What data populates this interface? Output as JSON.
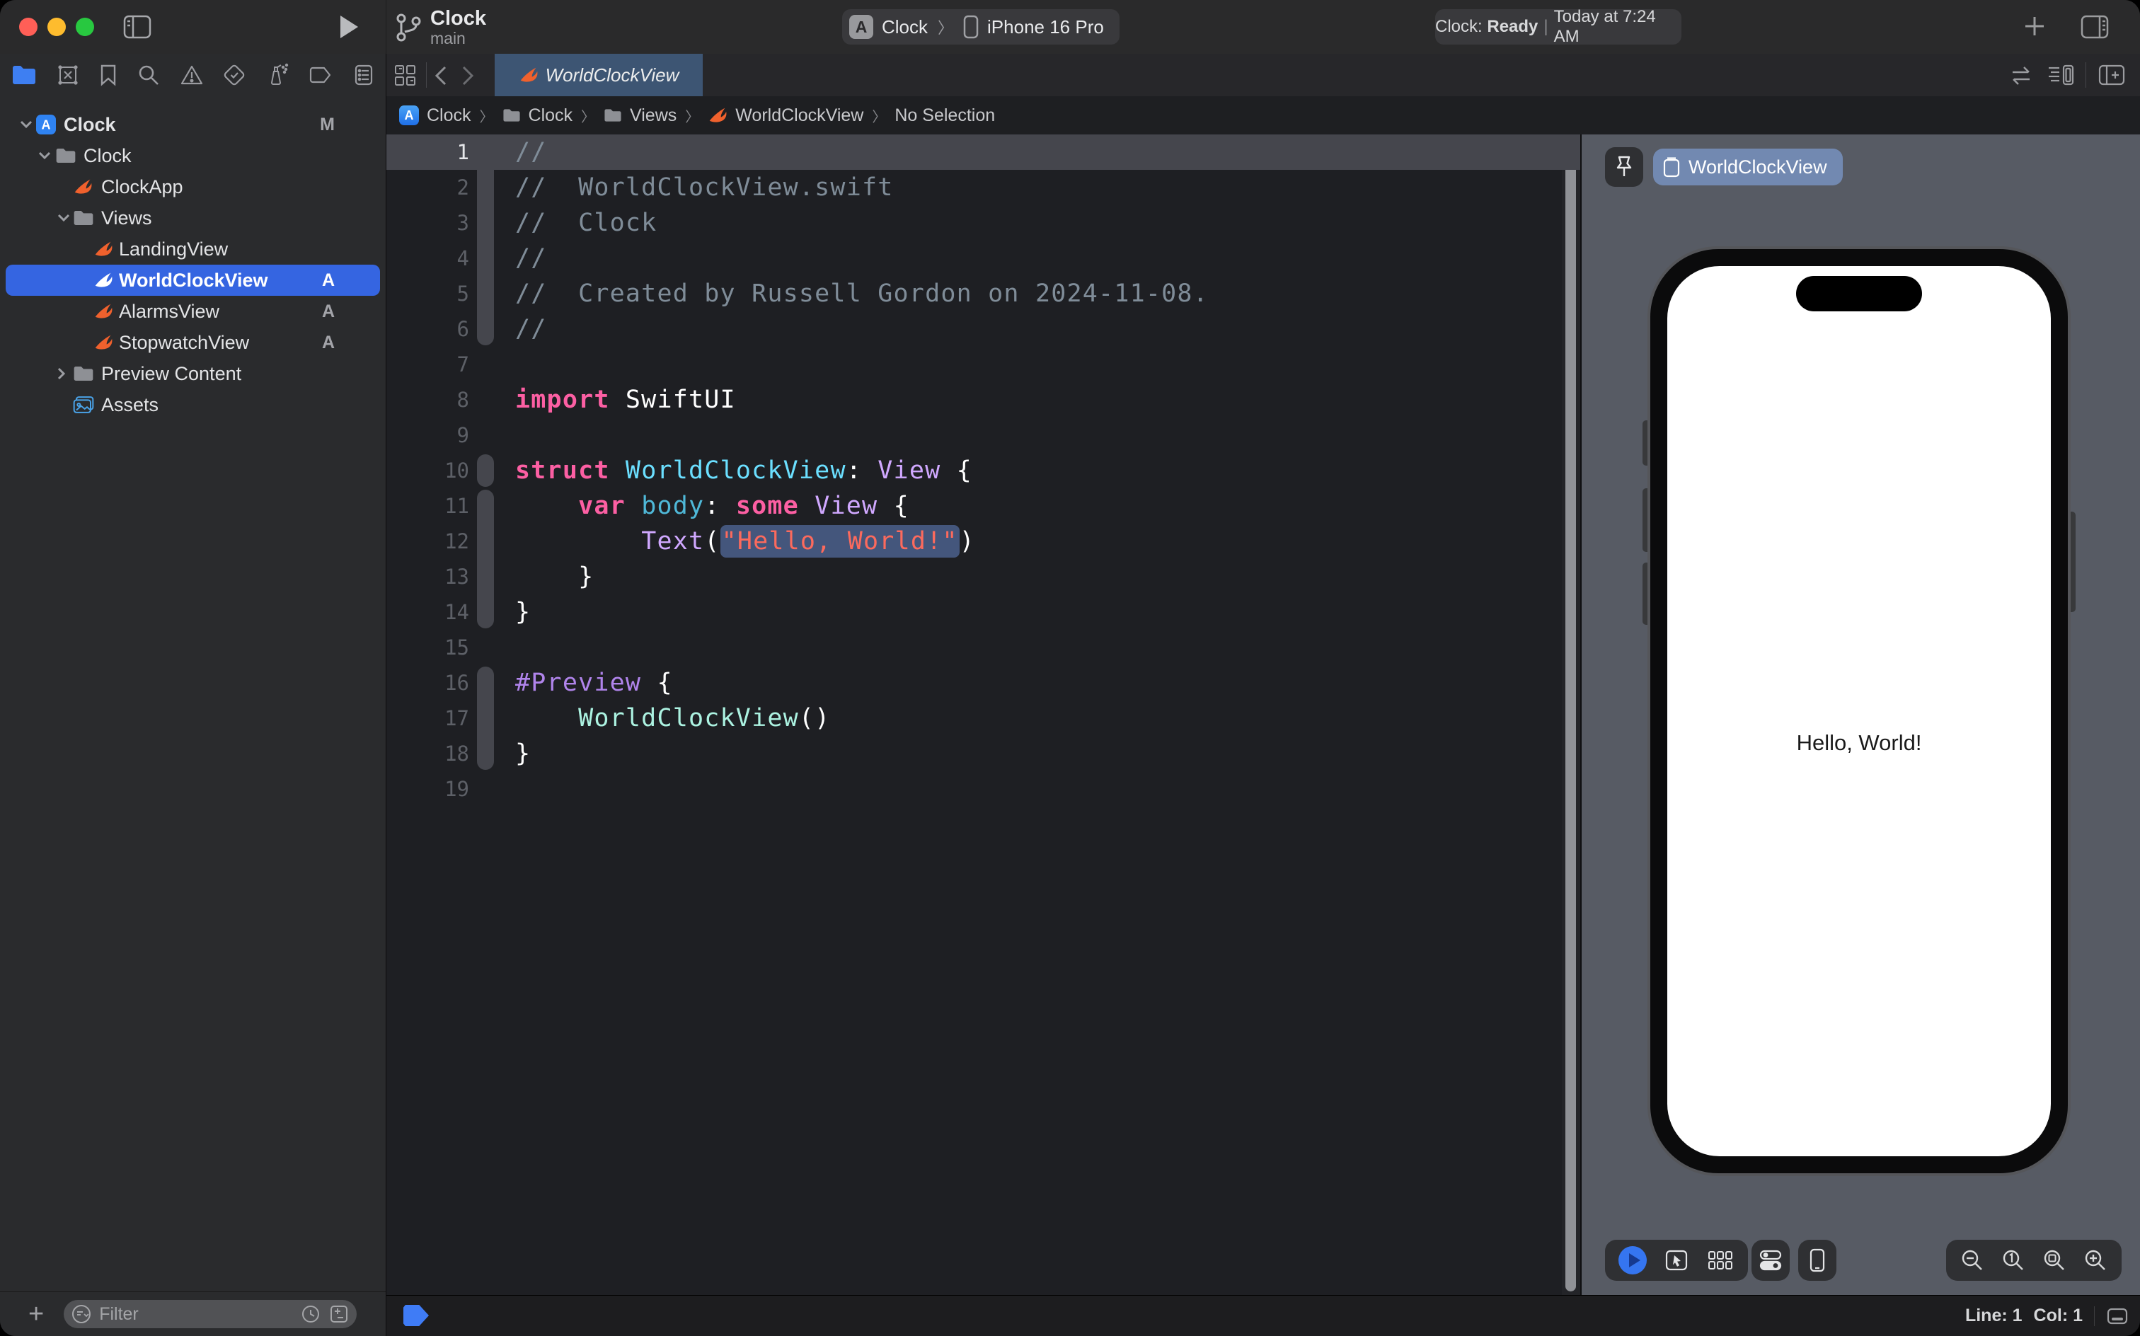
{
  "toolbar": {
    "branch_title": "Clock",
    "branch_subtitle": "main",
    "scheme_app": "Clock",
    "scheme_chip_letter": "A",
    "scheme_device": "iPhone 16 Pro",
    "status_app": "Clock:",
    "status_state": "Ready",
    "status_sep": "|",
    "status_time": "Today at 7:24 AM"
  },
  "sidebar": {
    "filter_placeholder": "Filter",
    "add_label": "+",
    "tree": [
      {
        "label": "Clock",
        "depth": 0,
        "icon": "project",
        "chevron": "down",
        "badge": "M",
        "selected": false,
        "bold": true
      },
      {
        "label": "Clock",
        "depth": 1,
        "icon": "folder",
        "chevron": "down",
        "badge": "",
        "selected": false
      },
      {
        "label": "ClockApp",
        "depth": 2,
        "icon": "swift",
        "chevron": "none",
        "badge": "",
        "selected": false
      },
      {
        "label": "Views",
        "depth": 2,
        "icon": "folder",
        "chevron": "down",
        "badge": "",
        "selected": false
      },
      {
        "label": "LandingView",
        "depth": 3,
        "icon": "swift",
        "chevron": "none",
        "badge": "",
        "selected": false
      },
      {
        "label": "WorldClockView",
        "depth": 3,
        "icon": "swift",
        "chevron": "none",
        "badge": "A",
        "selected": true
      },
      {
        "label": "AlarmsView",
        "depth": 3,
        "icon": "swift",
        "chevron": "none",
        "badge": "A",
        "selected": false
      },
      {
        "label": "StopwatchView",
        "depth": 3,
        "icon": "swift",
        "chevron": "none",
        "badge": "A",
        "selected": false
      },
      {
        "label": "Preview Content",
        "depth": 2,
        "icon": "folder",
        "chevron": "right",
        "badge": "",
        "selected": false
      },
      {
        "label": "Assets",
        "depth": 2,
        "icon": "assets",
        "chevron": "none",
        "badge": "",
        "selected": false
      }
    ]
  },
  "editor": {
    "tab_label": "WorldClockView",
    "breadcrumbs": [
      {
        "label": "Clock",
        "icon": "app"
      },
      {
        "label": "Clock",
        "icon": "folder"
      },
      {
        "label": "Views",
        "icon": "folder"
      },
      {
        "label": "WorldClockView",
        "icon": "swift"
      },
      {
        "label": "No Selection",
        "icon": "none"
      }
    ],
    "line_count": 19,
    "current_line": 1,
    "code_lines": [
      [
        [
          "cm",
          "//"
        ]
      ],
      [
        [
          "cm",
          "//  WorldClockView.swift"
        ]
      ],
      [
        [
          "cm",
          "//  Clock"
        ]
      ],
      [
        [
          "cm",
          "//"
        ]
      ],
      [
        [
          "cm",
          "//  Created by Russell Gordon on 2024-11-08."
        ]
      ],
      [
        [
          "cm",
          "//"
        ]
      ],
      [],
      [
        [
          "kw",
          "import"
        ],
        [
          "pl",
          " SwiftUI"
        ]
      ],
      [],
      [
        [
          "kw",
          "struct"
        ],
        [
          "pl",
          " "
        ],
        [
          "decl",
          "WorldClockView"
        ],
        [
          "pl",
          ": "
        ],
        [
          "type",
          "View"
        ],
        [
          "pl",
          " {"
        ]
      ],
      [
        [
          "pl",
          "    "
        ],
        [
          "kw",
          "var"
        ],
        [
          "pl",
          " "
        ],
        [
          "decl2",
          "body"
        ],
        [
          "pl",
          ": "
        ],
        [
          "kw",
          "some"
        ],
        [
          "pl",
          " "
        ],
        [
          "type",
          "View"
        ],
        [
          "pl",
          " {"
        ]
      ],
      [
        [
          "pl",
          "        "
        ],
        [
          "type",
          "Text"
        ],
        [
          "pl",
          "("
        ],
        [
          "strsel",
          "\"Hello, World!\""
        ],
        [
          "pl",
          ")"
        ]
      ],
      [
        [
          "pl",
          "    }"
        ]
      ],
      [
        [
          "pl",
          "}"
        ]
      ],
      [],
      [
        [
          "macro",
          "#Preview"
        ],
        [
          "pl",
          " {"
        ]
      ],
      [
        [
          "pl",
          "    "
        ],
        [
          "mint",
          "WorldClockView"
        ],
        [
          "pl",
          "()"
        ]
      ],
      [
        [
          "pl",
          "}"
        ]
      ],
      []
    ]
  },
  "preview": {
    "pill_label": "WorldClockView",
    "device_text": "Hello, World!"
  },
  "statusbar": {
    "line_label": "Line: 1",
    "col_label": "Col: 1"
  },
  "colors": {
    "accent_blue": "#3565e1",
    "tab_blue": "#3d5573",
    "canvas_gray": "#575b64",
    "swift_orange": "#f0612d",
    "keyword_pink": "#fc5fa3",
    "string_red": "#fc6a5d"
  }
}
